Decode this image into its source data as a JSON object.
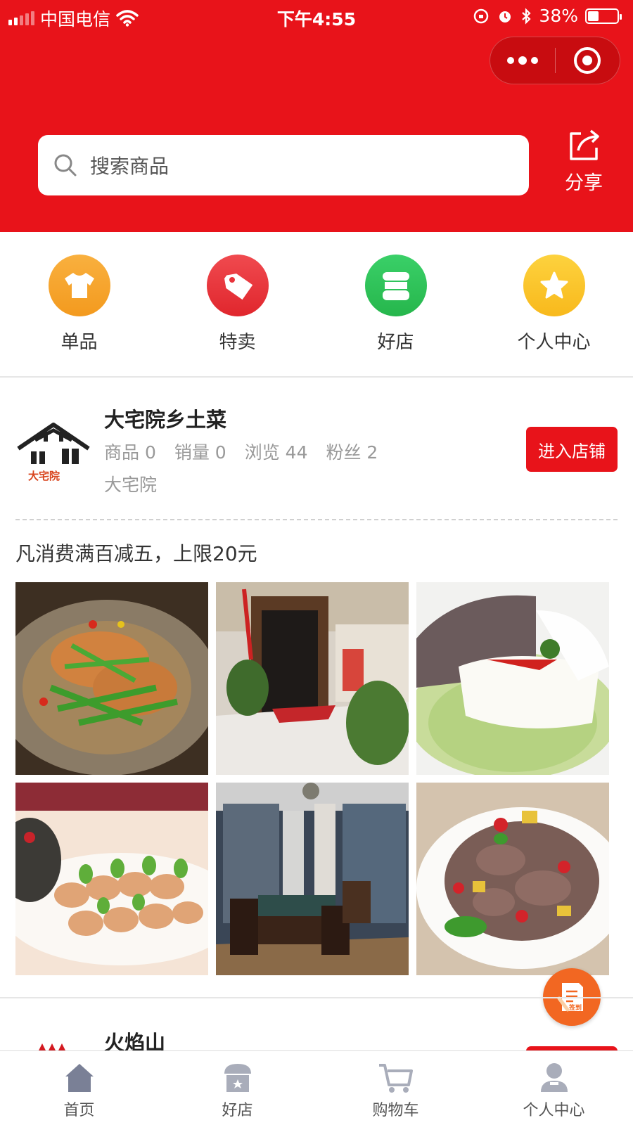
{
  "status_bar": {
    "carrier": "中国电信",
    "time": "下午4:55",
    "battery": "38%",
    "battery_level": 0.38
  },
  "search": {
    "placeholder": "搜索商品"
  },
  "share_label": "分享",
  "categories": [
    {
      "label": "单品",
      "icon": "shirt-icon",
      "color": "#f5a623"
    },
    {
      "label": "特卖",
      "icon": "tag-icon",
      "color": "#e8333b"
    },
    {
      "label": "好店",
      "icon": "store-icon",
      "color": "#2fc45a"
    },
    {
      "label": "个人中心",
      "icon": "star-icon",
      "color": "#fbc52d"
    }
  ],
  "shop": {
    "name": "大宅院乡土菜",
    "stats": {
      "goods": "商品 0",
      "sales": "销量 0",
      "views": "浏览 44",
      "fans": "粉丝 2"
    },
    "subtitle": "大宅院",
    "logo_text": "大宅院",
    "enter_label": "进入店铺",
    "promo": "凡消费满百减五，上限20元"
  },
  "shop2": {
    "name": "火焰山"
  },
  "sign_in_label": "签到",
  "tabbar": [
    {
      "label": "首页",
      "icon": "home-icon"
    },
    {
      "label": "好店",
      "icon": "store-icon"
    },
    {
      "label": "购物车",
      "icon": "cart-icon"
    },
    {
      "label": "个人中心",
      "icon": "user-icon"
    }
  ],
  "colors": {
    "brand_red": "#e8131a",
    "sign_orange": "#f26722"
  }
}
